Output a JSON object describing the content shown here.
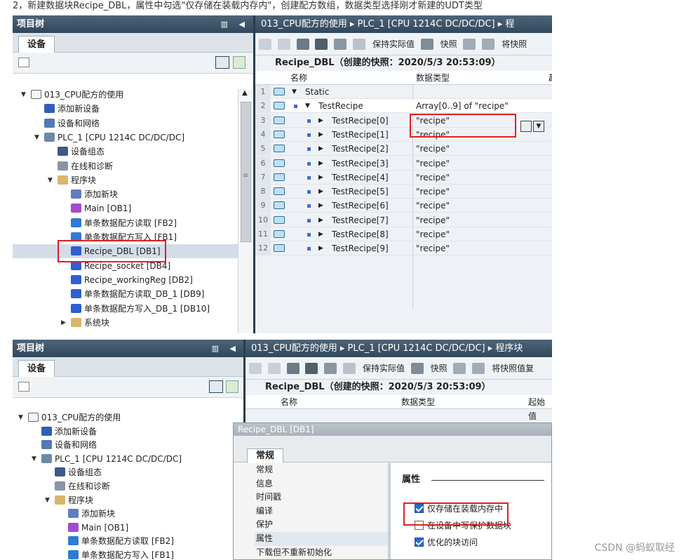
{
  "caption": "2，新建数据块Recipe_DBL，属性中勾选\"仅存储在装载内存内\"，创建配方数组，数据类型选择刚才新建的UDT类型",
  "watermark": "CSDN @蚂蚁取经",
  "tree": {
    "header": "项目树",
    "header_ctrl": "▥ ◀",
    "tab": "设备",
    "items": [
      {
        "label": "013_CPU配方的使用",
        "toggle": "▼",
        "icon": "project-icon"
      },
      {
        "label": "添加新设备",
        "icon": "add-device-icon"
      },
      {
        "label": "设备和网络",
        "icon": "network-icon"
      },
      {
        "label": "PLC_1 [CPU 1214C DC/DC/DC]",
        "toggle": "▼",
        "icon": "plc-icon"
      },
      {
        "label": "设备组态",
        "icon": "device-config-icon"
      },
      {
        "label": "在线和诊断",
        "icon": "diagnostics-icon"
      },
      {
        "label": "程序块",
        "toggle": "▼",
        "icon": "folder-icon"
      },
      {
        "label": "添加新块",
        "icon": "add-block-icon"
      },
      {
        "label": "Main [OB1]",
        "icon": "ob-icon"
      },
      {
        "label": "单条数据配方读取 [FB2]",
        "icon": "fb-icon"
      },
      {
        "label": "单条数据配方写入 [FB1]",
        "icon": "fb-icon"
      },
      {
        "label": "Recipe_DBL [DB1]",
        "icon": "db-icon"
      },
      {
        "label": "Recipe_socket [DB4]",
        "icon": "db-icon"
      },
      {
        "label": "Recipe_workingReg [DB2]",
        "icon": "db-icon"
      },
      {
        "label": "单条数据配方读取_DB_1 [DB9]",
        "icon": "db-icon"
      },
      {
        "label": "单条数据配方写入_DB_1 [DB10]",
        "icon": "db-icon"
      },
      {
        "label": "系统块",
        "toggle": "▶",
        "icon": "folder-icon"
      }
    ]
  },
  "editor1": {
    "breadcrumb": "013_CPU配方的使用 ▸ PLC_1 [CPU 1214C DC/DC/DC] ▸ 程",
    "toolbar_keep": "保持实际值",
    "toolbar_snapshot": "快照",
    "toolbar_copy": "将快照",
    "db_title": "Recipe_DBL（创建的快照：2020/5/3 20:53:09）",
    "col_name": "名称",
    "col_type": "数据类型",
    "col_extra": "起",
    "rows": [
      {
        "no": "1",
        "name": "Static",
        "type": "",
        "toggle": "▼"
      },
      {
        "no": "2",
        "name": "TestRecipe",
        "type": "Array[0..9] of \"recipe\"",
        "toggle": "▼"
      },
      {
        "no": "3",
        "name": "TestRecipe[0]",
        "type": "\"recipe\"",
        "toggle": "▶"
      },
      {
        "no": "4",
        "name": "TestRecipe[1]",
        "type": "\"recipe\"",
        "toggle": "▶"
      },
      {
        "no": "5",
        "name": "TestRecipe[2]",
        "type": "\"recipe\"",
        "toggle": "▶"
      },
      {
        "no": "6",
        "name": "TestRecipe[3]",
        "type": "\"recipe\"",
        "toggle": "▶"
      },
      {
        "no": "7",
        "name": "TestRecipe[4]",
        "type": "\"recipe\"",
        "toggle": "▶"
      },
      {
        "no": "8",
        "name": "TestRecipe[5]",
        "type": "\"recipe\"",
        "toggle": "▶"
      },
      {
        "no": "9",
        "name": "TestRecipe[6]",
        "type": "\"recipe\"",
        "toggle": "▶"
      },
      {
        "no": "10",
        "name": "TestRecipe[7]",
        "type": "\"recipe\"",
        "toggle": "▶"
      },
      {
        "no": "11",
        "name": "TestRecipe[8]",
        "type": "\"recipe\"",
        "toggle": "▶"
      },
      {
        "no": "12",
        "name": "TestRecipe[9]",
        "type": "\"recipe\"",
        "toggle": "▶"
      }
    ]
  },
  "editor2": {
    "breadcrumb": "013_CPU配方的使用 ▸ PLC_1 [CPU 1214C DC/DC/DC] ▸ 程序块",
    "toolbar_keep": "保持实际值",
    "toolbar_snapshot": "快照",
    "toolbar_copy": "将快照值复",
    "db_title": "Recipe_DBL（创建的快照：2020/5/3 20:53:09）",
    "col_name": "名称",
    "col_type": "数据类型",
    "col_start": "起始值"
  },
  "dialog": {
    "title": "Recipe_DBL [DB1]",
    "tab": "常规",
    "nav": [
      "常规",
      "信息",
      "时间戳",
      "编译",
      "保护",
      "属性",
      "下载但不重新初始化"
    ],
    "active_nav": "属性",
    "section": "属性",
    "checkboxes": [
      {
        "label": "仅存储在装载内存中",
        "checked": true
      },
      {
        "label": "在设备中写保护数据块",
        "checked": false
      },
      {
        "label": "优化的块访问",
        "checked": true
      }
    ]
  }
}
